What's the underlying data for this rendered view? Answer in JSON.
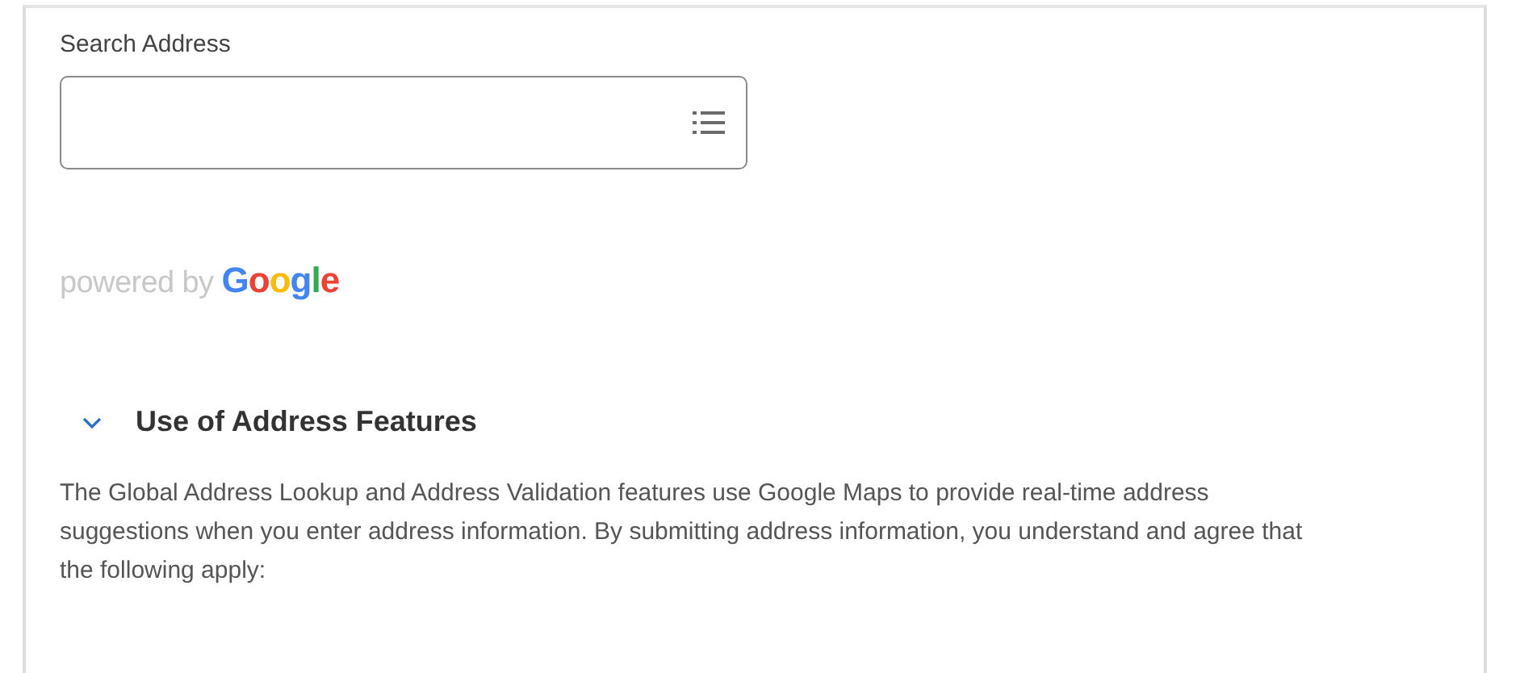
{
  "search_address": {
    "label": "Search Address"
  },
  "attribution": {
    "prefix": "powered by",
    "brand": "Google"
  },
  "section": {
    "title": "Use of Address Features",
    "expanded": true,
    "text": "The Global Address Lookup and Address Validation features use Google Maps to provide real-time address suggestions when you enter address information. By submitting address information, you understand and agree that the following apply:"
  }
}
